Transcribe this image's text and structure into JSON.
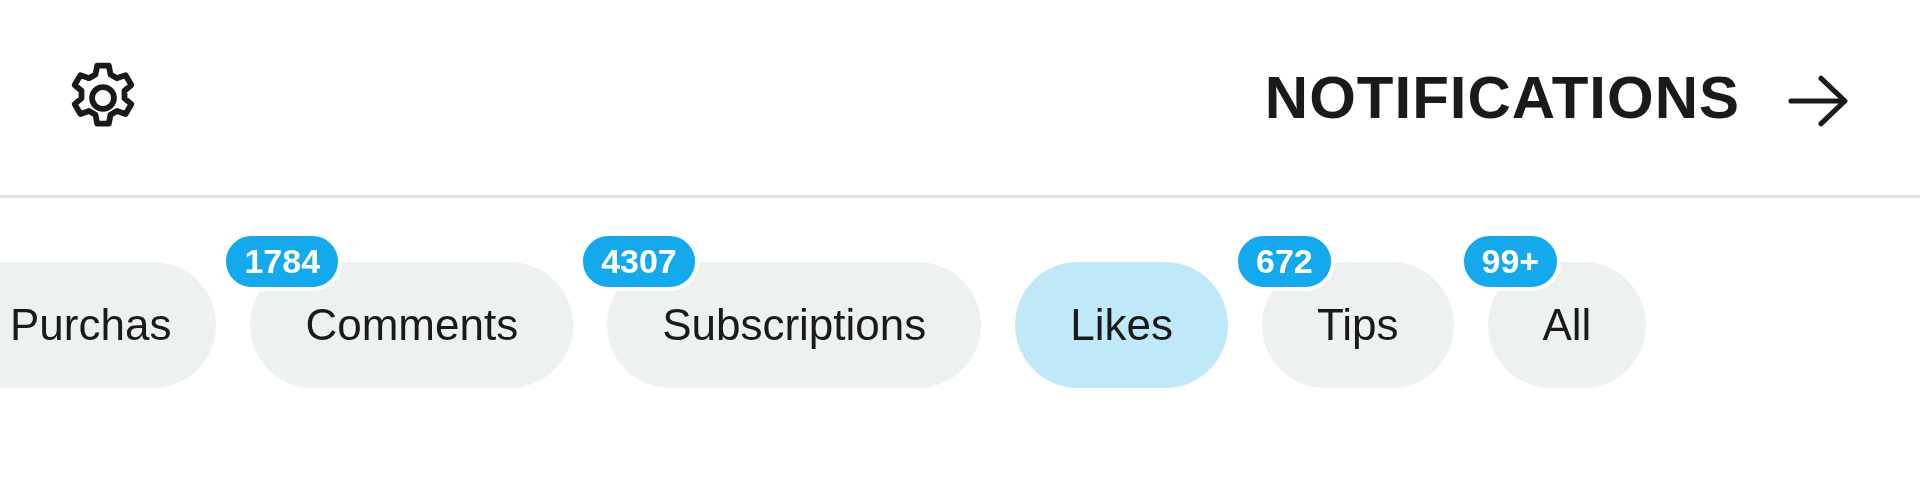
{
  "header": {
    "title": "NOTIFICATIONS"
  },
  "tabs": [
    {
      "label": "Purchas",
      "selected": false
    },
    {
      "label": "Comments",
      "badge": "1784",
      "selected": false
    },
    {
      "label": "Subscriptions",
      "badge": "4307",
      "selected": false
    },
    {
      "label": "Likes",
      "selected": true
    },
    {
      "label": "Tips",
      "badge": "672",
      "selected": false
    },
    {
      "label": "All",
      "badge": "99+",
      "selected": false
    }
  ]
}
